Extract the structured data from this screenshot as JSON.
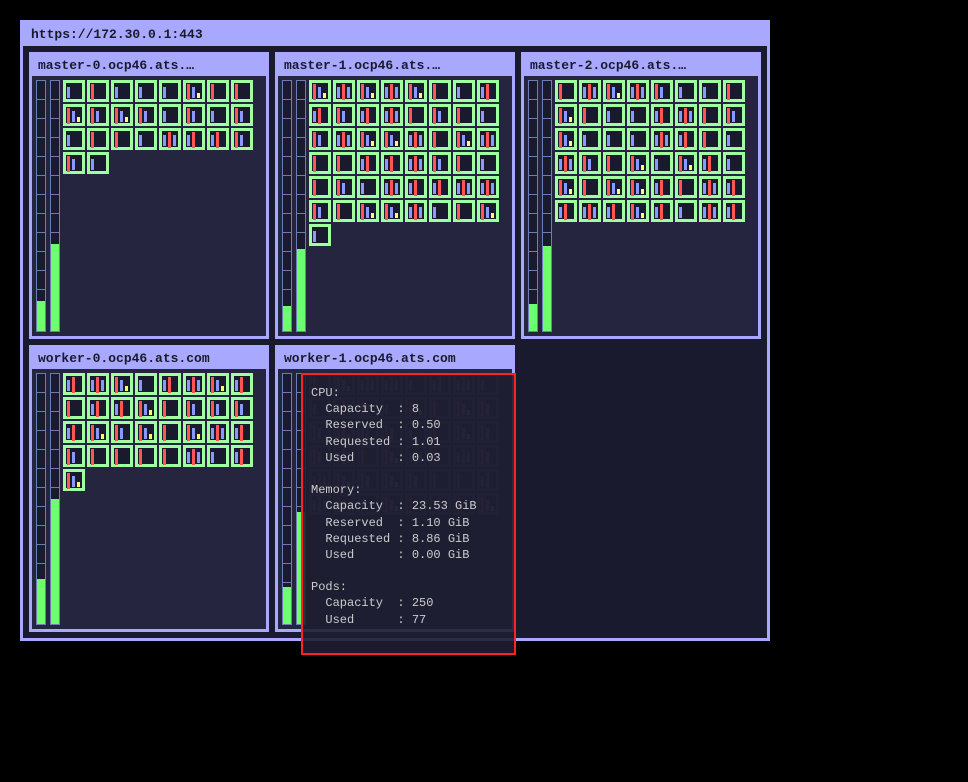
{
  "cluster": {
    "url": "https://172.30.0.1:443"
  },
  "nodes": [
    {
      "name": "master-0.ocp46.ats.…",
      "podCount": 26,
      "cpuFill": 12,
      "memFill": 35,
      "dimmed": false,
      "tooltip": null
    },
    {
      "name": "master-1.ocp46.ats.…",
      "podCount": 49,
      "cpuFill": 10,
      "memFill": 33,
      "dimmed": false,
      "tooltip": null
    },
    {
      "name": "master-2.ocp46.ats.…",
      "podCount": 48,
      "cpuFill": 11,
      "memFill": 34,
      "dimmed": false,
      "tooltip": null
    },
    {
      "name": "worker-0.ocp46.ats.com",
      "podCount": 33,
      "cpuFill": 18,
      "memFill": 50,
      "dimmed": false,
      "tooltip": null
    },
    {
      "name": "worker-1.ocp46.ats.com",
      "podCount": 48,
      "cpuFill": 15,
      "memFill": 45,
      "dimmed": true,
      "tooltip": {
        "cpu": {
          "label": "CPU:",
          "capacity_l": "Capacity",
          "capacity_v": "8",
          "reserved_l": "Reserved",
          "reserved_v": "0.50",
          "requested_l": "Requested",
          "requested_v": "1.01",
          "used_l": "Used",
          "used_v": "0.03"
        },
        "mem": {
          "label": "Memory:",
          "capacity_l": "Capacity",
          "capacity_v": "23.53 GiB",
          "reserved_l": "Reserved",
          "reserved_v": "1.10 GiB",
          "requested_l": "Requested",
          "requested_v": "8.86 GiB",
          "used_l": "Used",
          "used_v": "0.00 GiB"
        },
        "pods": {
          "label": "Pods:",
          "capacity_l": "Capacity",
          "capacity_v": "250",
          "used_l": "Used",
          "used_v": "77"
        }
      }
    }
  ]
}
